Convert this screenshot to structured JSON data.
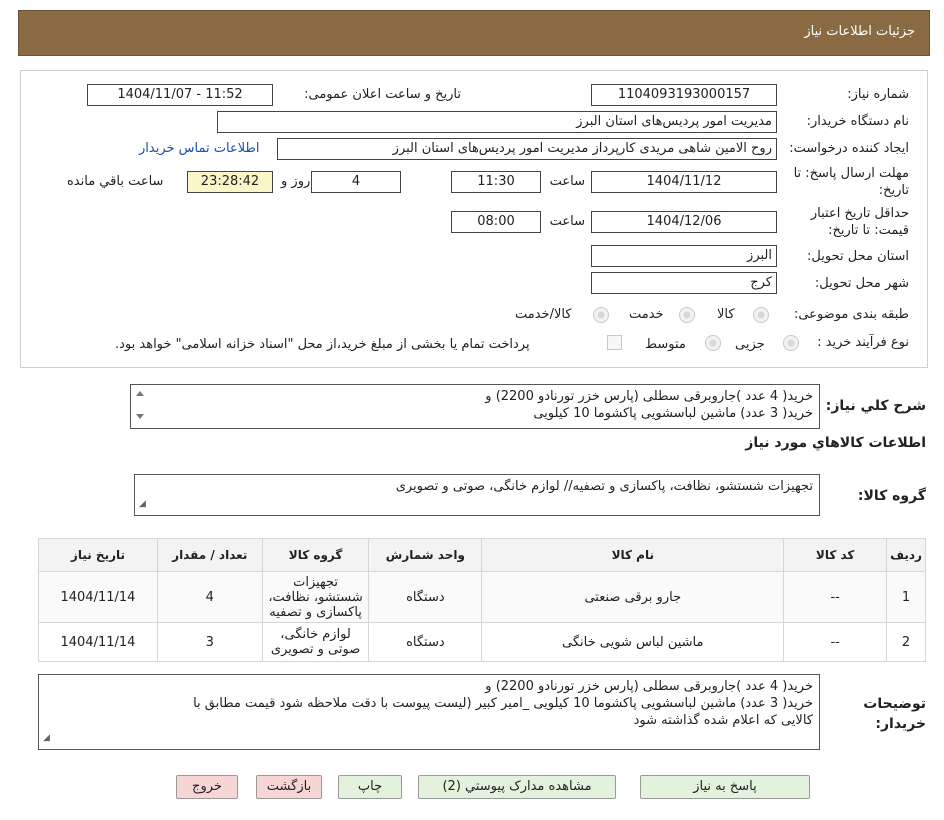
{
  "header": {
    "title": "جزئیات اطلاعات نیاز"
  },
  "fields": {
    "need_number_label": "شماره نیاز:",
    "need_number": "1104093193000157",
    "announce_label": "تاریخ و ساعت اعلان عمومی:",
    "announce_value": "1404/11/07 - 11:52",
    "buyer_org_label": "نام دستگاه خریدار:",
    "buyer_org": "مدیریت امور پردیس‌های استان البرز",
    "requester_label": "ایجاد کننده درخواست:",
    "requester": "روح الامین شاهی مریدی کارپرداز مدیریت امور پردیس‌های استان البرز",
    "contact_link": "اطلاعات تماس خریدار",
    "deadline_label": "مهلت ارسال پاسخ: تا تاریخ:",
    "deadline_date": "1404/11/12",
    "time_label": "ساعت",
    "deadline_time": "11:30",
    "days": "4",
    "days_label": "روز و",
    "remaining": "23:28:42",
    "remaining_label": "ساعت باقي مانده",
    "validity_label": "حداقل تاريخ اعتبار قيمت: تا تاريخ:",
    "validity_date": "1404/12/06",
    "validity_time": "08:00",
    "province_label": "استان محل تحویل:",
    "province": "البرز",
    "city_label": "شهر محل تحویل:",
    "city": "کرج",
    "category_label": "طبقه بندی موضوعی:",
    "category_options": [
      "کالا",
      "خدمت",
      "کالا/خدمت"
    ],
    "process_label": "نوع فرآیند خرید :",
    "process_options": [
      "جزیی",
      "متوسط"
    ],
    "payment_note": "پرداخت تمام یا بخشی از مبلغ خرید،از محل \"اسناد خزانه اسلامی\" خواهد بود."
  },
  "summary": {
    "label": "شرح کلي نياز:",
    "line1": "خرید( 4 عدد )جاروبرقی سطلی (پارس خزر تورنادو 2200) و",
    "line2": "خرید( 3 عدد) ماشین لباسشویی پاکشوما 10 کیلویی"
  },
  "goods_section_title": "اطلاعات کالاهاي مورد نياز",
  "goods_group": {
    "label": "گروه کالا:",
    "value": "تجهیزات شستشو، نظافت، پاکسازی و تصفیه// لوازم خانگی، صوتی و تصویری"
  },
  "table": {
    "headers": [
      "ردیف",
      "کد کالا",
      "نام کالا",
      "واحد شمارش",
      "گروه کالا",
      "تعداد / مقدار",
      "تاریخ نیاز"
    ],
    "rows": [
      [
        "1",
        "--",
        "جارو برقی صنعتی",
        "دستگاه",
        "تجهیزات شستشو، نظافت، پاکسازی و تصفیه",
        "4",
        "1404/11/14"
      ],
      [
        "2",
        "--",
        "ماشین لباس شویی خانگی",
        "دستگاه",
        "لوازم خانگی، صوتی و تصویری",
        "3",
        "1404/11/14"
      ]
    ]
  },
  "buyer_notes": {
    "label": "توضیحات خریدار:",
    "line1": "خرید( 4 عدد )جاروبرقی سطلی (پارس خزر تورنادو 2200) و",
    "line2": "خرید( 3 عدد) ماشین لباسشویی پاکشوما 10 کیلویی _امیر کبیر (لیست پیوست با دقت ملاحظه شود قیمت مطابق با",
    "line3": "کالایی که اعلام شده گذاشته شود"
  },
  "buttons": {
    "reply": "پاسخ به نیاز",
    "attachments": "مشاهده مدارک پیوستي (2)",
    "print": "چاپ",
    "back": "بازگشت",
    "exit": "خروج"
  },
  "colors": {
    "header_bg": "#8a6a43",
    "link": "#1a4fb0",
    "yellow_box": "#fbf6c8"
  }
}
